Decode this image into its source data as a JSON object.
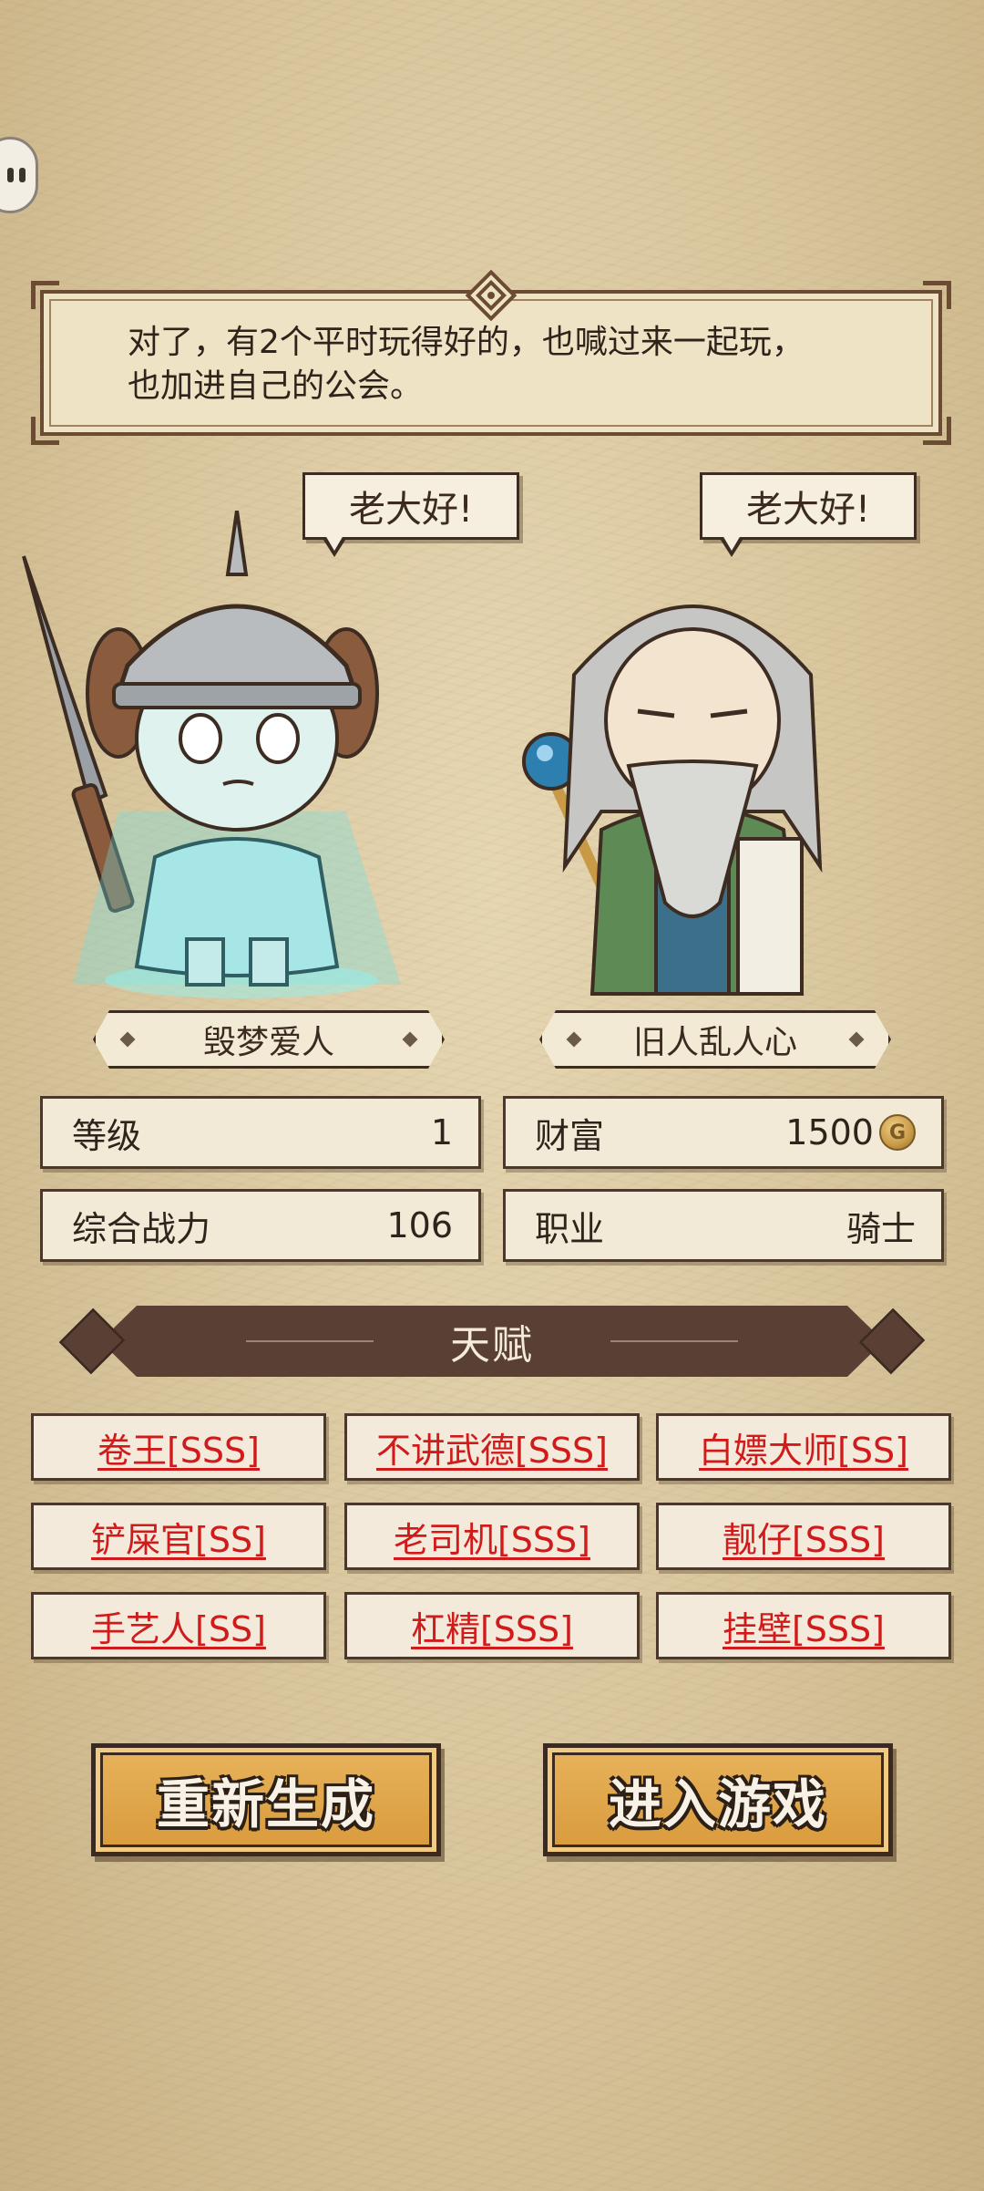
{
  "dialog": {
    "line1": "对了，有2个平时玩得好的，也喊过来一起玩，",
    "line2": "也加进自己的公会。"
  },
  "characters": [
    {
      "greeting": "老大好!",
      "name": "毁梦爱人",
      "type": "knight"
    },
    {
      "greeting": "老大好!",
      "name": "旧人乱人心",
      "type": "wizard"
    }
  ],
  "stats": {
    "level_label": "等级",
    "level_value": "1",
    "wealth_label": "财富",
    "wealth_value": "1500",
    "power_label": "综合战力",
    "power_value": "106",
    "job_label": "职业",
    "job_value": "骑士"
  },
  "talent_title": "天赋",
  "talents": [
    "卷王[SSS]",
    "不讲武德[SSS]",
    "白嫖大师[SS]",
    "铲屎官[SS]",
    "老司机[SSS]",
    "靓仔[SSS]",
    "手艺人[SS]",
    "杠精[SSS]",
    "挂壁[SSS]"
  ],
  "buttons": {
    "regenerate": "重新生成",
    "enter": "进入游戏"
  },
  "colors": {
    "talent_text": "#d11b1b",
    "button_fill": "#d99a3c",
    "banner": "#5a4034"
  }
}
